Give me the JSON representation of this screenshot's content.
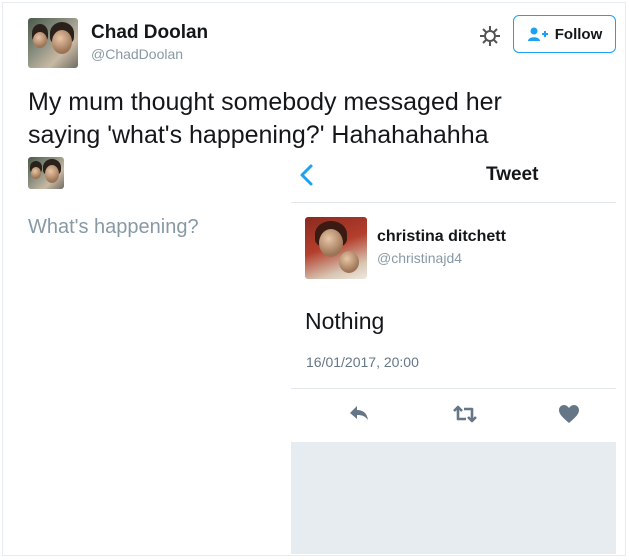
{
  "author": {
    "name": "Chad Doolan",
    "handle": "@ChadDoolan"
  },
  "toolbar": {
    "follow_label": "Follow"
  },
  "tweet": {
    "line1": "My mum thought somebody messaged her",
    "line2": "saying 'what's happening?' Hahahahahha"
  },
  "compose": {
    "placeholder": "What's happening?"
  },
  "inner": {
    "header_title": "Tweet",
    "author_name": "christina ditchett",
    "author_handle": "@christinajd4",
    "text": "Nothing",
    "timestamp": "16/01/2017, 20:00",
    "actions": [
      "reply-icon",
      "retweet-icon",
      "like-icon"
    ]
  },
  "colors": {
    "accent": "#1da1f2",
    "muted": "#8899a6",
    "icon_gray": "#657786"
  }
}
